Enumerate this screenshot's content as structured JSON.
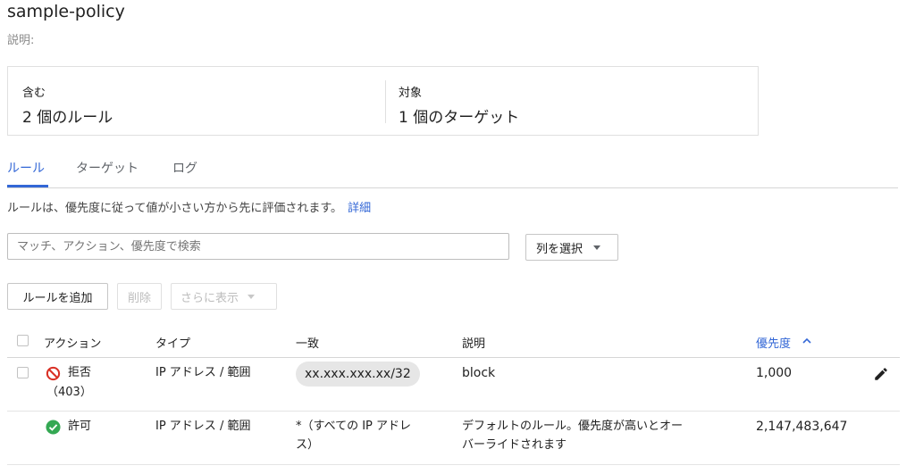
{
  "header": {
    "title": "sample-policy",
    "description_label": "説明:"
  },
  "summary": {
    "includes_label": "含む",
    "includes_value": "2 個のルール",
    "targets_label": "対象",
    "targets_value": "1 個のターゲット"
  },
  "tabs": {
    "items": [
      {
        "label": "ルール",
        "active": true
      },
      {
        "label": "ターゲット",
        "active": false
      },
      {
        "label": "ログ",
        "active": false
      }
    ]
  },
  "info": {
    "text": "ルールは、優先度に従って値が小さい方から先に評価されます。",
    "link": "詳細"
  },
  "search": {
    "placeholder": "マッチ、アクション、優先度で検索",
    "value": ""
  },
  "toolbar": {
    "column_select_label": "列を選択",
    "add_rule_label": "ルールを追加",
    "delete_label": "削除",
    "more_label": "さらに表示"
  },
  "table": {
    "headers": {
      "action": "アクション",
      "type": "タイプ",
      "match": "一致",
      "description": "説明",
      "priority": "優先度"
    },
    "sort": {
      "column": "priority",
      "direction": "ascending"
    },
    "rows": [
      {
        "action": "拒否",
        "action_code": "（403）",
        "action_icon": "deny-icon",
        "type": "IP アドレス / 範囲",
        "match": "xx.xxx.xxx.xx/32",
        "description": "block",
        "priority": "1,000",
        "editable": true
      },
      {
        "action": "許可",
        "action_icon": "allow-icon",
        "type": "IP アドレス / 範囲",
        "match_line1": "*（すべての IP アドレ",
        "match_line2": "ス）",
        "description_line1": "デフォルトのルール。優先度が高いとオー",
        "description_line2": "バーライドされます",
        "priority": "2,147,483,647",
        "editable": false
      }
    ]
  },
  "colors": {
    "accent": "#3367d6",
    "deny": "#d93025",
    "allow": "#34a853",
    "chip_bg": "#e6e6e6"
  }
}
